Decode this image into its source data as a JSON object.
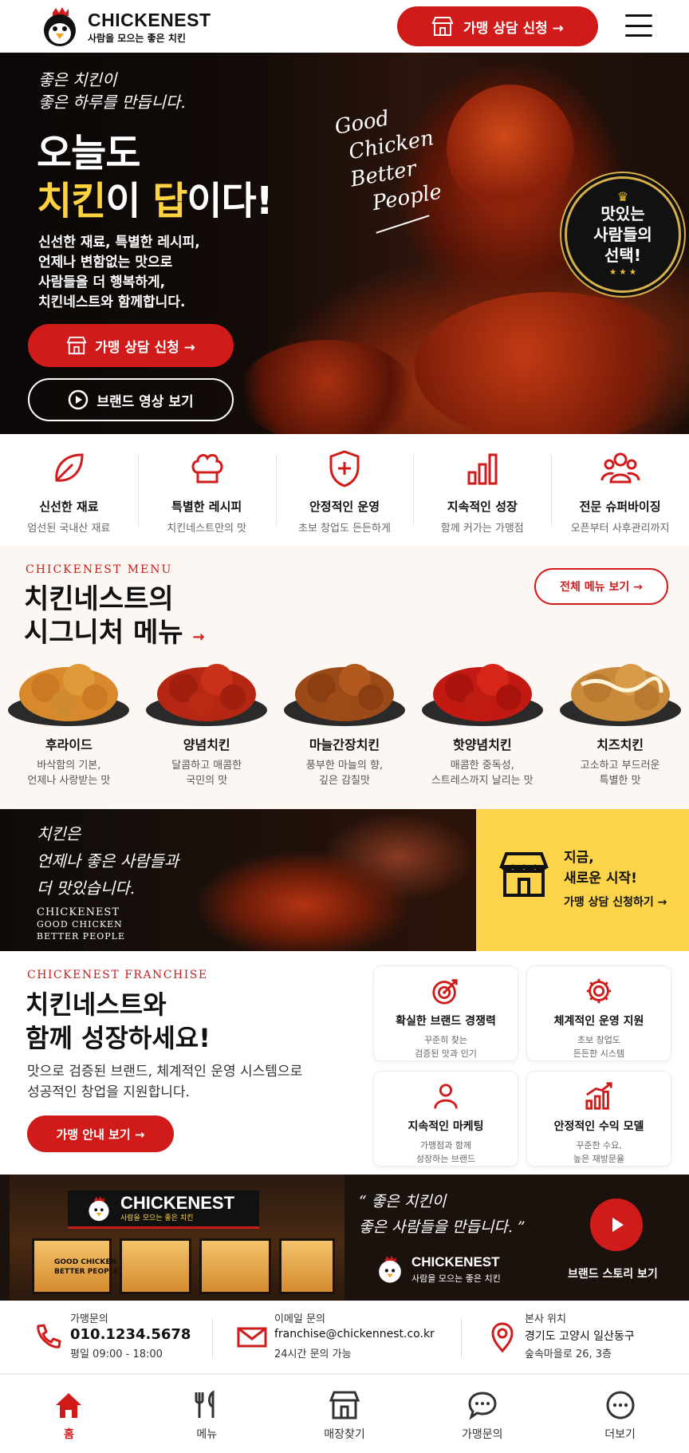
{
  "header": {
    "brand": "CHICKENEST",
    "slogan": "사람을 모으는 좋은 치킨",
    "cta_label": "가맹 상담 신청 →"
  },
  "hero": {
    "script_line1": "좋은 치킨이",
    "script_line2": "좋은 하루를 만듭니다.",
    "title_line1": "오늘도",
    "title_word1": "치킨",
    "title_mid": "이 ",
    "title_word2": "답",
    "title_end": "이다!",
    "desc_line1": "신선한 재료, 특별한 레시피,",
    "desc_line2": "언제나 변함없는 맛으로",
    "desc_line3": "사람들을 더 행복하게,",
    "desc_line4": "치킨네스트와 함께합니다.",
    "primary_button": "가맹 상담 신청 →",
    "secondary_button": "브랜드 영상 보기",
    "tagline_line1": "Good",
    "tagline_line2": "Chicken",
    "tagline_line3": "Better",
    "tagline_line4": "People",
    "badge_line1": "맛있는",
    "badge_line2": "사람들의",
    "badge_line3": "선택!"
  },
  "features": [
    {
      "title": "신선한 재료",
      "sub": "엄선된 국내산 재료",
      "icon": "leaf-icon"
    },
    {
      "title": "특별한 레시피",
      "sub": "치킨네스트만의 맛",
      "icon": "chef-hat-icon"
    },
    {
      "title": "안정적인 운영",
      "sub": "초보 창업도 든든하게",
      "icon": "shield-plus-icon"
    },
    {
      "title": "지속적인 성장",
      "sub": "함께 커가는 가맹점",
      "icon": "bar-chart-icon"
    },
    {
      "title": "전문 슈퍼바이징",
      "sub": "오픈부터 사후관리까지",
      "icon": "team-icon"
    }
  ],
  "menu": {
    "kicker": "CHICKENEST MENU",
    "title_line1": "치킨네스트의",
    "title_line2": "시그니처 메뉴",
    "arrow": "→",
    "all_button": "전체 메뉴 보기 →",
    "items": [
      {
        "name": "후라이드",
        "desc1": "바삭함의 기본,",
        "desc2": "언제나 사랑받는 맛",
        "color": "#d8892c"
      },
      {
        "name": "양념치킨",
        "desc1": "달콤하고 매콤한",
        "desc2": "국민의 맛",
        "color": "#b52712"
      },
      {
        "name": "마늘간장치킨",
        "desc1": "풍부한 마늘의 향,",
        "desc2": "깊은 감칠맛",
        "color": "#9c4a18"
      },
      {
        "name": "핫양념치킨",
        "desc1": "매콤한 중독성,",
        "desc2": "스트레스까지 날리는 맛",
        "color": "#c21a12"
      },
      {
        "name": "치즈치킨",
        "desc1": "고소하고 부드러운",
        "desc2": "특별한 맛",
        "color": "#c98a3a"
      }
    ]
  },
  "promo": {
    "script_line1": "치킨은",
    "script_line2": "언제나 좋은 사람들과",
    "script_line3": "더 맛있습니다.",
    "brand_line1": "CHICKENEST",
    "brand_line2": "GOOD CHICKEN",
    "brand_line3": "BETTER PEOPLE",
    "cta_line1": "지금,",
    "cta_line2": "새로운 시작!",
    "cta_link": "가맹 상담 신청하기 →"
  },
  "franchise": {
    "kicker": "CHICKENEST FRANCHISE",
    "title_line1": "치킨네스트와",
    "title_line2": "함께 성장하세요!",
    "desc_line1": "맛으로 검증된 브랜드, 체계적인 운영 시스템으로",
    "desc_line2": "성공적인 창업을 지원합니다.",
    "button": "가맹 안내 보기 →",
    "cards": [
      {
        "title": "확실한 브랜드 경쟁력",
        "desc1": "꾸준히 찾는",
        "desc2": "검증된 맛과 인기",
        "icon": "target-icon"
      },
      {
        "title": "체계적인 운영 지원",
        "desc1": "초보 창업도",
        "desc2": "든든한 시스템",
        "icon": "gear-icon"
      },
      {
        "title": "지속적인 마케팅",
        "desc1": "가맹점과 함께",
        "desc2": "성장하는 브랜드",
        "icon": "people-icon"
      },
      {
        "title": "안정적인 수익 모델",
        "desc1": "꾸준한 수요,",
        "desc2": "높은 재방문율",
        "icon": "growth-chart-icon"
      }
    ]
  },
  "store": {
    "sign_name": "CHICKENEST",
    "sign_slogan": "사람을 모으는 좋은 치킨",
    "window_line1": "GOOD CHICKEN",
    "window_line2": "BETTER PEOPLE",
    "quote_line1": "“ 좋은 치킨이",
    "quote_line2": "좋은 사람들을 만듭니다. ”",
    "logo_name": "CHICKENEST",
    "logo_sub": "사람을 모으는 좋은 치킨",
    "story_label": "브랜드 스토리 보기"
  },
  "contact": {
    "phone_label": "가맹문의",
    "phone": "010.1234.5678",
    "phone_hours": "평일 09:00 - 18:00",
    "email_label": "이메일 문의",
    "email": "franchise@chickennest.co.kr",
    "email_note": "24시간 문의 가능",
    "address_label": "본사 위치",
    "address_line1": "경기도 고양시 일산동구",
    "address_line2": "숲속마을로 26, 3층"
  },
  "bottom_nav": [
    {
      "label": "홈",
      "icon": "home-icon"
    },
    {
      "label": "메뉴",
      "icon": "utensils-icon"
    },
    {
      "label": "매장찾기",
      "icon": "store-icon"
    },
    {
      "label": "가맹문의",
      "icon": "chat-icon"
    },
    {
      "label": "더보기",
      "icon": "more-icon"
    }
  ],
  "colors": {
    "brand_red": "#d11a1a",
    "accent_yellow": "#ffd23f",
    "banner_yellow": "#fcd44a"
  }
}
